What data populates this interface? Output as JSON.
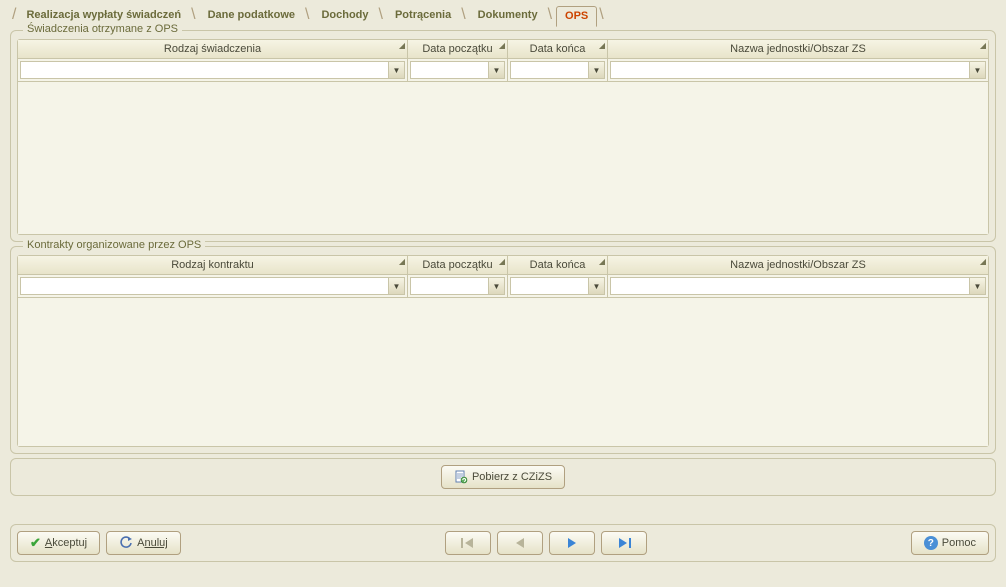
{
  "tabs": {
    "t0": "Realizacja wypłaty świadczeń",
    "t1": "Dane podatkowe",
    "t2": "Dochody",
    "t3": "Potrącenia",
    "t4": "Dokumenty",
    "t5": "OPS"
  },
  "group1": {
    "legend": "Świadczenia otrzymane z OPS",
    "cols": {
      "c1": "Rodzaj świadczenia",
      "c2": "Data początku",
      "c3": "Data końca",
      "c4": "Nazwa jednostki/Obszar ZS"
    }
  },
  "group2": {
    "legend": "Kontrakty organizowane przez OPS",
    "cols": {
      "c1": "Rodzaj kontraktu",
      "c2": "Data początku",
      "c3": "Data końca",
      "c4": "Nazwa jednostki/Obszar ZS"
    }
  },
  "buttons": {
    "fetch": "Pobierz z CZiZS",
    "accept_pre": "A",
    "accept_rest": "kceptuj",
    "cancel_pre": "A",
    "cancel_rest": "nuluj",
    "help": "Pomoc"
  }
}
